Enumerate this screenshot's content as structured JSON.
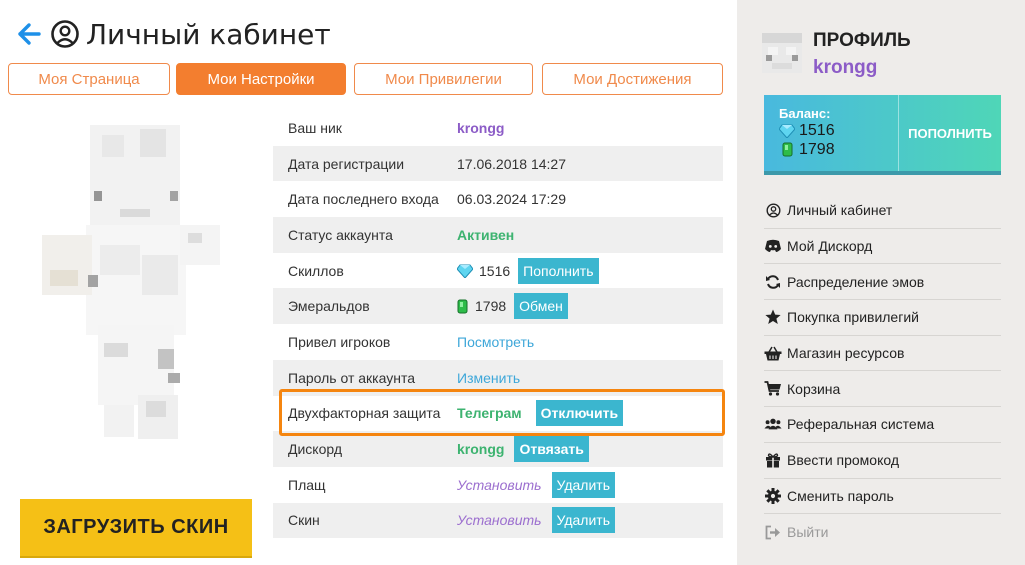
{
  "header": {
    "title": "Личный кабинет"
  },
  "tabs": [
    {
      "label": "Моя Страница",
      "active": false
    },
    {
      "label": "Мои Настройки",
      "active": true
    },
    {
      "label": "Мои Привилегии",
      "active": false
    },
    {
      "label": "Мои Достижения",
      "active": false
    }
  ],
  "upload_skin_label": "ЗАГРУЗИТЬ СКИН",
  "table": {
    "nick": {
      "label": "Ваш ник",
      "value": "krongg"
    },
    "registered": {
      "label": "Дата регистрации",
      "value": "17.06.2018 14:27"
    },
    "last_login": {
      "label": "Дата последнего входа",
      "value": "06.03.2024 17:29"
    },
    "status": {
      "label": "Статус аккаунта",
      "value": "Активен"
    },
    "skills": {
      "label": "Скиллов",
      "value": "1516",
      "button": "Пополнить"
    },
    "emeralds": {
      "label": "Эмеральдов",
      "value": "1798",
      "button": "Обмен"
    },
    "referrals": {
      "label": "Привел игроков",
      "link": "Посмотреть"
    },
    "password": {
      "label": "Пароль от аккаунта",
      "link": "Изменить"
    },
    "twofa": {
      "label": "Двухфакторная защита",
      "value": "Телеграм",
      "button": "Отключить"
    },
    "discord": {
      "label": "Дискорд",
      "value": "krongg",
      "button": "Отвязать"
    },
    "cape": {
      "label": "Плащ",
      "link": "Установить",
      "button": "Удалить"
    },
    "skin": {
      "label": "Скин",
      "link": "Установить",
      "button": "Удалить"
    }
  },
  "sidebar": {
    "profile_title": "ПРОФИЛЬ",
    "profile_name": "krongg",
    "balance": {
      "caption": "Баланс:",
      "skills": "1516",
      "emeralds": "1798",
      "topup_label": "ПОПОЛНИТЬ"
    },
    "menu": [
      {
        "label": "Личный кабинет",
        "icon": "user-circle-icon"
      },
      {
        "label": "Мой Дискорд",
        "icon": "discord-icon"
      },
      {
        "label": "Распределение эмов",
        "icon": "sync-icon"
      },
      {
        "label": "Покупка привилегий",
        "icon": "star-icon"
      },
      {
        "label": "Магазин ресурсов",
        "icon": "basket-icon"
      },
      {
        "label": "Корзина",
        "icon": "cart-icon"
      },
      {
        "label": "Реферальная система",
        "icon": "users-icon"
      },
      {
        "label": "Ввести промокод",
        "icon": "gift-icon"
      },
      {
        "label": "Сменить пароль",
        "icon": "gear-icon"
      },
      {
        "label": "Выйти",
        "icon": "sign-out-icon"
      }
    ]
  },
  "colors": {
    "accent_orange": "#f37e2f",
    "teal_button": "#3bb6cf",
    "purple_text": "#8c5cc7",
    "green_text": "#3db370",
    "upload_yellow": "#f5c016"
  }
}
